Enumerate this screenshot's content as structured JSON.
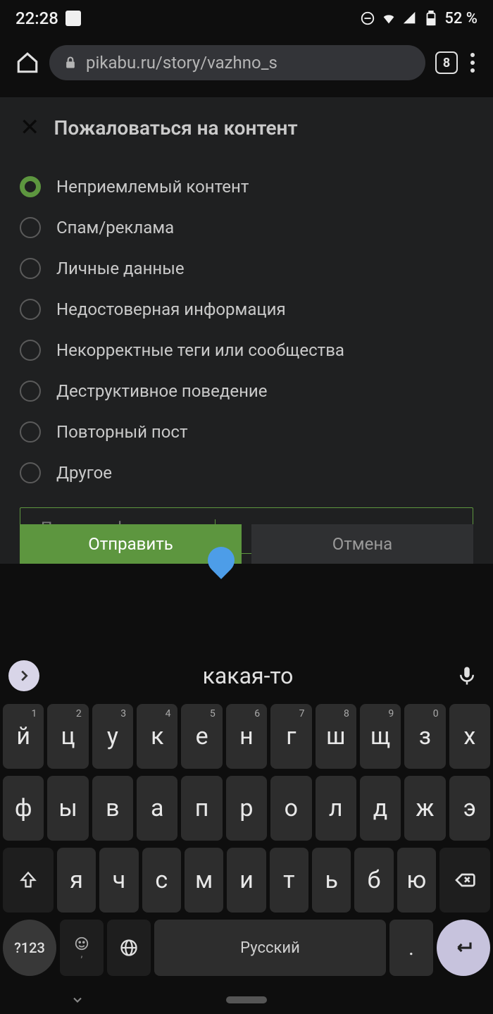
{
  "status": {
    "time": "22:28",
    "battery": "52 %"
  },
  "browser": {
    "url": "pikabu.ru/story/vazhno_s",
    "tabs": "8"
  },
  "modal": {
    "title": "Пожаловаться на контент",
    "options": [
      "Неприемлемый контент",
      "Спам/реклама",
      "Личные данные",
      "Недостоверная информация",
      "Некорректные теги или сообщества",
      "Деструктивное поведение",
      "Повторный пост",
      "Другое"
    ],
    "input_text": "Порнография какая-то",
    "submit": "Отправить",
    "cancel": "Отмена"
  },
  "keyboard": {
    "suggestion": "какая-то",
    "row1": [
      {
        "k": "й",
        "n": "1"
      },
      {
        "k": "ц",
        "n": "2"
      },
      {
        "k": "у",
        "n": "3"
      },
      {
        "k": "к",
        "n": "4"
      },
      {
        "k": "е",
        "n": "5"
      },
      {
        "k": "н",
        "n": "6"
      },
      {
        "k": "г",
        "n": "7"
      },
      {
        "k": "ш",
        "n": "8"
      },
      {
        "k": "щ",
        "n": "9"
      },
      {
        "k": "з",
        "n": "0"
      },
      {
        "k": "х",
        "n": ""
      }
    ],
    "row2": [
      "ф",
      "ы",
      "в",
      "а",
      "п",
      "р",
      "о",
      "л",
      "д",
      "ж",
      "э"
    ],
    "row3": [
      "я",
      "ч",
      "с",
      "м",
      "и",
      "т",
      "ь",
      "б",
      "ю"
    ],
    "space": "Русский",
    "numkey": "?123",
    "comma": ",",
    "dot": "."
  }
}
